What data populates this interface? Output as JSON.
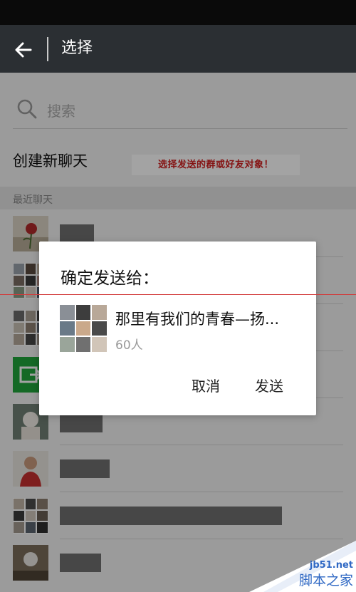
{
  "app_bar": {
    "title": "选择"
  },
  "search": {
    "placeholder": "搜索"
  },
  "new_chat_label": "创建新聊天",
  "annotation_text": "选择发送的群或好友对象！",
  "section_label": "最近聊天",
  "contacts": [
    {
      "avatar": "rose-photo"
    },
    {
      "avatar": "group-collage"
    },
    {
      "avatar": "group-collage"
    },
    {
      "avatar": "green-share-icon"
    },
    {
      "avatar": "baby-photo"
    },
    {
      "avatar": "person-red-shirt"
    },
    {
      "avatar": "group-collage"
    },
    {
      "avatar": "dark-photo"
    }
  ],
  "dialog": {
    "title": "确定发送给：",
    "group_name": "那里有我们的青春—扬...",
    "member_count": "60人",
    "cancel_label": "取消",
    "send_label": "发送"
  },
  "watermark": {
    "line1": "jb51.net",
    "line2": "脚本之家"
  },
  "colors": {
    "app_bar": "#2b2f33",
    "status_bar": "#0a0a0a",
    "annotation_red": "#d01f1f",
    "share_green": "#20a53a",
    "watermark_blue": "#2f68c4"
  }
}
